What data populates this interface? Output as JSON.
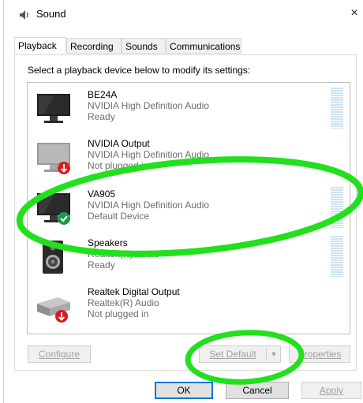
{
  "window": {
    "title": "Sound",
    "close_glyph": "×"
  },
  "tabs": [
    {
      "label": "Playback",
      "active": true
    },
    {
      "label": "Recording",
      "active": false
    },
    {
      "label": "Sounds",
      "active": false
    },
    {
      "label": "Communications",
      "active": false
    }
  ],
  "instruction": "Select a playback device below to modify its settings:",
  "devices": [
    {
      "name": "BE24A",
      "driver": "NVIDIA High Definition Audio",
      "status": "Ready",
      "icon": "monitor-icon"
    },
    {
      "name": "NVIDIA Output",
      "driver": "NVIDIA High Definition Audio",
      "status": "Not plugged in",
      "icon": "monitor-unplugged-icon"
    },
    {
      "name": "VA905",
      "driver": "NVIDIA High Definition Audio",
      "status": "Default Device",
      "icon": "monitor-default-icon"
    },
    {
      "name": "Speakers",
      "driver": "Realtek(R) Audio",
      "status": "Ready",
      "icon": "speaker-icon"
    },
    {
      "name": "Realtek Digital Output",
      "driver": "Realtek(R) Audio",
      "status": "Not plugged in",
      "icon": "digital-output-icon"
    }
  ],
  "buttons": {
    "configure": "Configure",
    "set_default": "Set Default",
    "properties": "Properties",
    "ok": "OK",
    "cancel": "Cancel",
    "apply": "Apply"
  },
  "colors": {
    "annotation": "#22e01e",
    "meter": "#cfe3f0",
    "default_check": "#1a9b4b",
    "unplugged_badge": "#d11f1f"
  }
}
